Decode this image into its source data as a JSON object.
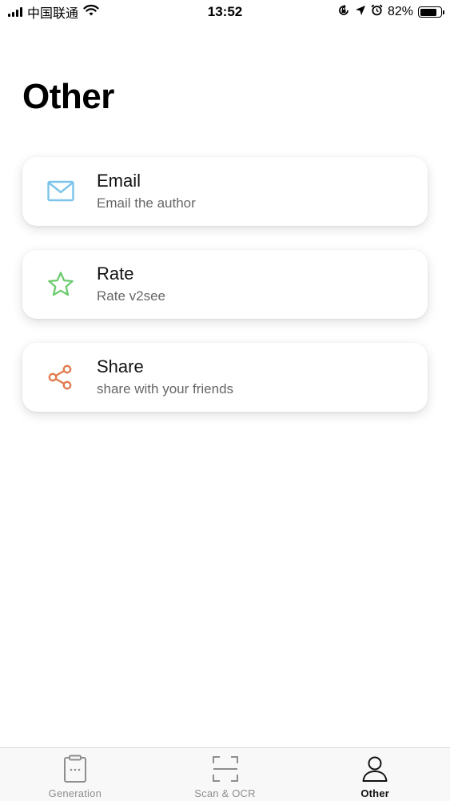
{
  "status_bar": {
    "carrier": "中国联通",
    "time": "13:52",
    "battery_percent": "82%",
    "battery_level": 0.82,
    "icons": [
      "signal-icon",
      "wifi-icon",
      "orientation-lock-icon",
      "location-icon",
      "alarm-icon",
      "battery-icon"
    ]
  },
  "page": {
    "title": "Other"
  },
  "items": [
    {
      "title": "Email",
      "subtitle": "Email the author",
      "icon": "mail-icon",
      "icon_color": "#7CC4EA"
    },
    {
      "title": "Rate",
      "subtitle": "Rate v2see",
      "icon": "star-icon",
      "icon_color": "#6CCB6F"
    },
    {
      "title": "Share",
      "subtitle": "share with your friends",
      "icon": "share-icon",
      "icon_color": "#E07A4E"
    }
  ],
  "tab_bar": {
    "tabs": [
      {
        "label": "Generation",
        "icon": "clipboard-icon",
        "active": false
      },
      {
        "label": "Scan & OCR",
        "icon": "scan-frame-icon",
        "active": false
      },
      {
        "label": "Other",
        "icon": "person-icon",
        "active": true
      }
    ]
  },
  "colors": {
    "inactive_tab": "#8E8E8E",
    "active_tab": "#111111"
  }
}
